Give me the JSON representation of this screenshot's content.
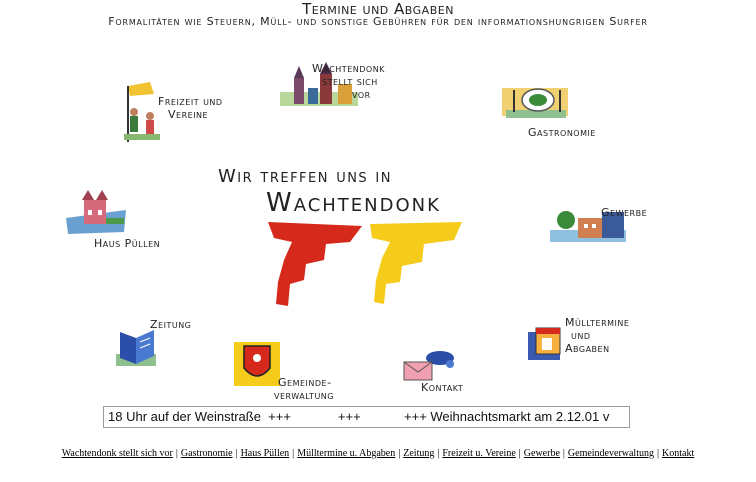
{
  "header": {
    "title": "Termine und Abgaben",
    "subtitle": "Formalitäten wie Steuern, Müll- und sonstige Gebühren für den informationshungrigen Surfer"
  },
  "center": {
    "line1": "Wir treffen uns in",
    "line2": "Wachtendonk"
  },
  "icons": {
    "wachtendonk": {
      "l1": "Wachtendonk",
      "l2": "stellt sich",
      "l3": "vor"
    },
    "freizeit": {
      "l1": "Freizeit und",
      "l2": "Vereine"
    },
    "gastronomie": {
      "l1": "Gastronomie"
    },
    "haus": {
      "l1": "Haus Püllen"
    },
    "gewerbe": {
      "l1": "Gewerbe"
    },
    "zeitung": {
      "l1": "Zeitung"
    },
    "gemeinde": {
      "l1": "Gemeinde-",
      "l2": "verwaltung"
    },
    "kontakt": {
      "l1": "Kontakt"
    },
    "muell": {
      "l1": "Mülltermine",
      "l2": "und",
      "l3": "Abgaben"
    }
  },
  "ticker": {
    "text": "18 Uhr auf der Weinstraße  +++             +++            +++ Weihnachtsmarkt am 2.12.01 v"
  },
  "footer": {
    "links": [
      "Wachtendonk stellt sich vor",
      "Gastronomie",
      "Haus Püllen",
      "Mülltermine u. Abgaben",
      "Zeitung",
      "Freizeit u. Vereine",
      "Gewerbe",
      "Gemeindeverwaltung",
      "Kontakt"
    ],
    "separator": "|"
  },
  "colors": {
    "red": "#d4291b",
    "yellow": "#f5cc1c",
    "accent_blue": "#2b4fa8"
  }
}
